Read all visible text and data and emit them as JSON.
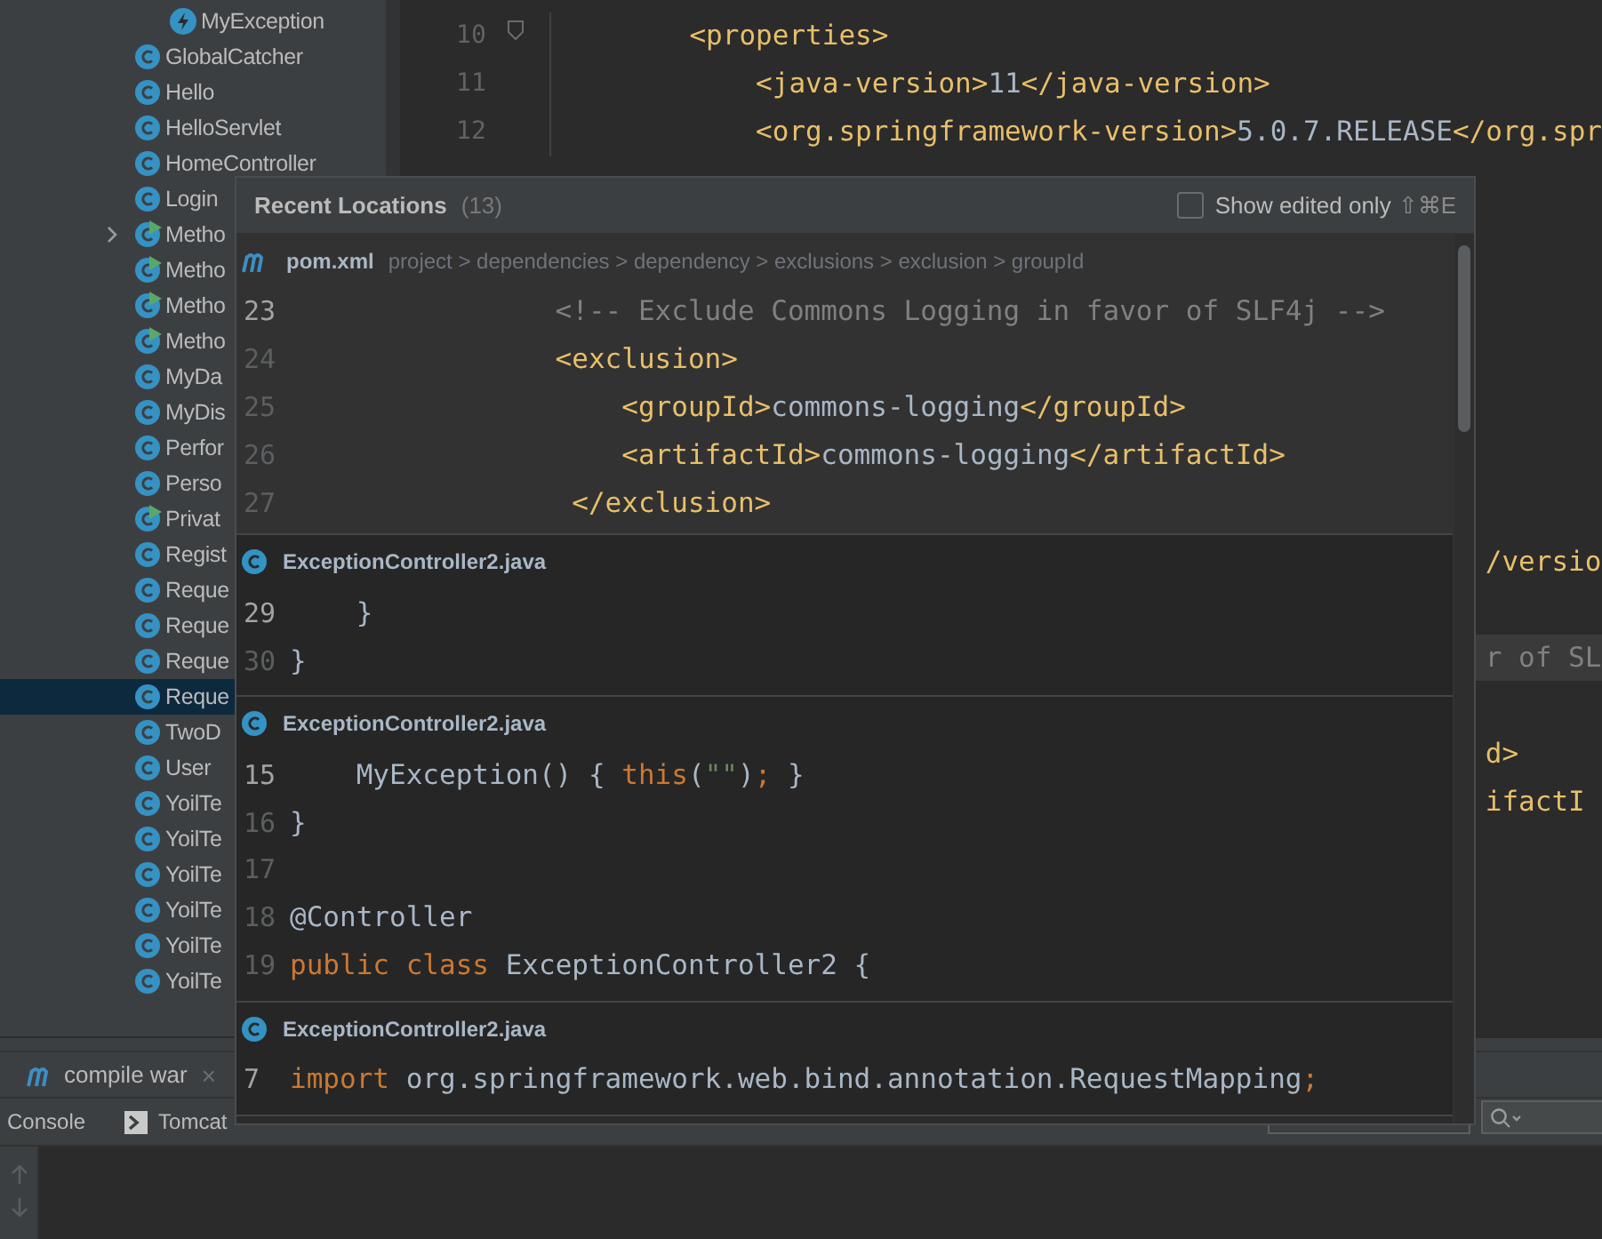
{
  "project_tree": {
    "items": [
      {
        "name": "MyException",
        "kind": "exception",
        "runnable": false,
        "selected": false
      },
      {
        "name": "GlobalCatcher",
        "kind": "class",
        "runnable": false,
        "selected": false
      },
      {
        "name": "Hello",
        "kind": "class",
        "runnable": false,
        "selected": false
      },
      {
        "name": "HelloServlet",
        "kind": "class",
        "runnable": false,
        "selected": false
      },
      {
        "name": "HomeController",
        "kind": "class",
        "runnable": false,
        "selected": false
      },
      {
        "name": "Login",
        "kind": "class",
        "runnable": false,
        "selected": false
      },
      {
        "name": "Metho",
        "kind": "class",
        "runnable": true,
        "selected": false,
        "expanded": false
      },
      {
        "name": "Metho",
        "kind": "class",
        "runnable": true,
        "selected": false
      },
      {
        "name": "Metho",
        "kind": "class",
        "runnable": true,
        "selected": false
      },
      {
        "name": "Metho",
        "kind": "class",
        "runnable": true,
        "selected": false
      },
      {
        "name": "MyDa",
        "kind": "class",
        "runnable": false,
        "selected": false
      },
      {
        "name": "MyDis",
        "kind": "class",
        "runnable": false,
        "selected": false
      },
      {
        "name": "Perfor",
        "kind": "class",
        "runnable": false,
        "selected": false
      },
      {
        "name": "Perso",
        "kind": "class",
        "runnable": false,
        "selected": false
      },
      {
        "name": "Privat",
        "kind": "class",
        "runnable": true,
        "selected": false
      },
      {
        "name": "Regist",
        "kind": "class",
        "runnable": false,
        "selected": false
      },
      {
        "name": "Reque",
        "kind": "class",
        "runnable": false,
        "selected": false
      },
      {
        "name": "Reque",
        "kind": "class",
        "runnable": false,
        "selected": false
      },
      {
        "name": "Reque",
        "kind": "class",
        "runnable": false,
        "selected": false
      },
      {
        "name": "Reque",
        "kind": "class",
        "runnable": false,
        "selected": true
      },
      {
        "name": "TwoD",
        "kind": "class",
        "runnable": false,
        "selected": false
      },
      {
        "name": "User",
        "kind": "class",
        "runnable": false,
        "selected": false
      },
      {
        "name": "YoilTe",
        "kind": "class",
        "runnable": false,
        "selected": false
      },
      {
        "name": "YoilTe",
        "kind": "class",
        "runnable": false,
        "selected": false
      },
      {
        "name": "YoilTe",
        "kind": "class",
        "runnable": false,
        "selected": false
      },
      {
        "name": "YoilTe",
        "kind": "class",
        "runnable": false,
        "selected": false
      },
      {
        "name": "YoilTe",
        "kind": "class",
        "runnable": false,
        "selected": false
      },
      {
        "name": "YoilTe",
        "kind": "class",
        "runnable": false,
        "selected": false
      }
    ]
  },
  "editor": {
    "lines": [
      {
        "number": "10",
        "foldable": true,
        "tokens": [
          {
            "kind": "tag",
            "text": "    <properties>"
          }
        ]
      },
      {
        "number": "11",
        "foldable": false,
        "tokens": [
          {
            "kind": "tag",
            "text": "        <java-version>"
          },
          {
            "kind": "plain",
            "text": "11"
          },
          {
            "kind": "tag",
            "text": "</java-version>"
          }
        ]
      },
      {
        "number": "12",
        "foldable": false,
        "tokens": [
          {
            "kind": "tag",
            "text": "        <org.springframework-version>"
          },
          {
            "kind": "plain",
            "text": "5.0.7.RELEASE"
          },
          {
            "kind": "tag",
            "text": "</org.spr"
          }
        ]
      }
    ],
    "fragments": [
      {
        "highlighted": false,
        "tokens": [
          {
            "kind": "tag",
            "text": "/versio"
          }
        ]
      },
      {
        "highlighted": true,
        "tokens": [
          {
            "kind": "comment",
            "text": "r of SL"
          }
        ]
      },
      {
        "highlighted": false,
        "tokens": [
          {
            "kind": "tag",
            "text": "d>"
          }
        ]
      },
      {
        "highlighted": false,
        "tokens": [
          {
            "kind": "tag",
            "text": "ifactI"
          }
        ]
      }
    ]
  },
  "recent_locations": {
    "title": "Recent Locations",
    "count": "(13)",
    "show_edited_only": {
      "label": "Show edited only",
      "checked": false,
      "shortcut": "⇧⌘E"
    },
    "entries": [
      {
        "file": "pom.xml",
        "kind": "maven",
        "breadcrumb": "project > dependencies > dependency > exclusions > exclusion > groupId",
        "selected": true,
        "lines": [
          {
            "number": "23",
            "current": true,
            "tokens": [
              {
                "kind": "comment",
                "text": "                <!-- Exclude Commons Logging in favor of SLF4j -->"
              }
            ]
          },
          {
            "number": "24",
            "current": false,
            "tokens": [
              {
                "kind": "tag",
                "text": "                <exclusion>"
              }
            ]
          },
          {
            "number": "25",
            "current": false,
            "tokens": [
              {
                "kind": "tag",
                "text": "                    <groupId>"
              },
              {
                "kind": "plain",
                "text": "commons-logging"
              },
              {
                "kind": "tag",
                "text": "</groupId>"
              }
            ]
          },
          {
            "number": "26",
            "current": false,
            "tokens": [
              {
                "kind": "tag",
                "text": "                    <artifactId>"
              },
              {
                "kind": "plain",
                "text": "commons-logging"
              },
              {
                "kind": "tag",
                "text": "</artifactId>"
              }
            ]
          },
          {
            "number": "27",
            "current": false,
            "tokens": [
              {
                "kind": "tag",
                "text": "                 </exclusion>"
              }
            ]
          }
        ]
      },
      {
        "file": "ExceptionController2.java",
        "kind": "class",
        "selected": false,
        "lines": [
          {
            "number": "29",
            "current": true,
            "tokens": [
              {
                "kind": "plain",
                "text": "    }"
              }
            ]
          },
          {
            "number": "30",
            "current": false,
            "tokens": [
              {
                "kind": "plain",
                "text": "}"
              }
            ]
          }
        ]
      },
      {
        "file": "ExceptionController2.java",
        "kind": "class",
        "selected": false,
        "lines": [
          {
            "number": "15",
            "current": true,
            "tokens": [
              {
                "kind": "plain",
                "text": "    MyException() { "
              },
              {
                "kind": "keyword",
                "text": "this"
              },
              {
                "kind": "plain",
                "text": "("
              },
              {
                "kind": "string",
                "text": "\"\""
              },
              {
                "kind": "plain",
                "text": ")"
              },
              {
                "kind": "keyword",
                "text": ";"
              },
              {
                "kind": "plain",
                "text": " }"
              }
            ]
          },
          {
            "number": "16",
            "current": false,
            "tokens": [
              {
                "kind": "plain",
                "text": "}"
              }
            ]
          },
          {
            "number": "17",
            "current": false
          },
          {
            "number": "18",
            "current": false,
            "tokens": [
              {
                "kind": "plain",
                "text": "@Controller"
              }
            ]
          },
          {
            "number": "19",
            "current": false,
            "tokens": [
              {
                "kind": "keyword",
                "text": "public class "
              },
              {
                "kind": "plain",
                "text": "ExceptionController2 {"
              }
            ]
          }
        ]
      },
      {
        "file": "ExceptionController2.java",
        "kind": "class",
        "selected": false,
        "lines": [
          {
            "number": "7",
            "current": true,
            "tokens": [
              {
                "kind": "keyword",
                "text": "import "
              },
              {
                "kind": "plain",
                "text": "org.springframework.web.bind.annotation.RequestMapping"
              },
              {
                "kind": "keyword",
                "text": ";"
              }
            ]
          }
        ]
      }
    ]
  },
  "run_tabs": [
    {
      "label": "compile war",
      "kind": "maven",
      "close": "×",
      "selected": true
    }
  ],
  "tool_tabs": [
    {
      "label": "Console",
      "kind": "plain",
      "selected": false
    },
    {
      "label": "Tomcat",
      "kind": "terminal",
      "selected": false
    }
  ]
}
